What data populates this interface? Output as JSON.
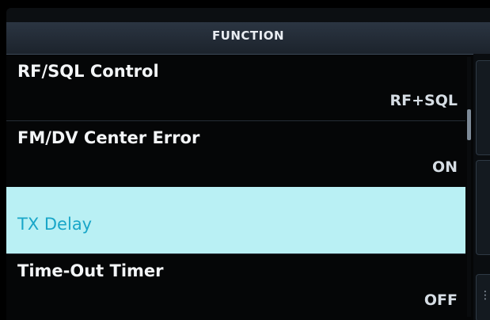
{
  "header": {
    "title": "FUNCTION"
  },
  "menu": {
    "items": [
      {
        "label": "RF/SQL Control",
        "value": "RF+SQL",
        "selected": false
      },
      {
        "label": "FM/DV Center Error",
        "value": "ON",
        "selected": false
      },
      {
        "label": "TX Delay",
        "value": "",
        "selected": true
      },
      {
        "label": "Time-Out Timer",
        "value": "OFF",
        "selected": false
      }
    ]
  },
  "scrollbar": {
    "position_fraction": 0.23,
    "visible_fraction": 0.12
  },
  "side_panel": {
    "buttons": [
      {
        "icon": "scroll-up-icon",
        "glyph": ""
      },
      {
        "icon": "scroll-down-icon",
        "glyph": ""
      },
      {
        "icon": "more-icon",
        "glyph": "⋮"
      }
    ]
  },
  "colors": {
    "selected_background": "#b9f0f4",
    "selected_text": "#19a6c8",
    "title_bar": "#243040"
  }
}
